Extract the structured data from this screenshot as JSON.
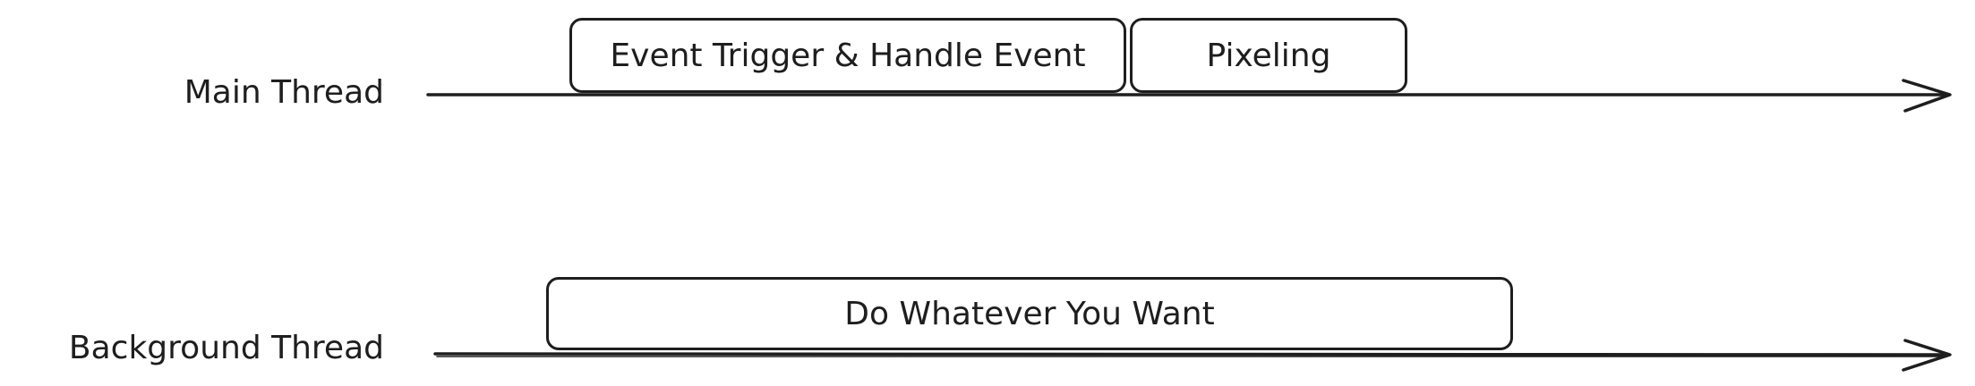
{
  "lanes": {
    "main": {
      "label": "Main Thread",
      "blocks": [
        {
          "label": "Event Trigger & Handle Event"
        },
        {
          "label": "Pixeling"
        }
      ]
    },
    "background": {
      "label": "Background Thread",
      "blocks": [
        {
          "label": "Do Whatever You Want"
        }
      ]
    }
  },
  "colors": {
    "stroke": "#1e1e1e",
    "background": "#ffffff"
  }
}
